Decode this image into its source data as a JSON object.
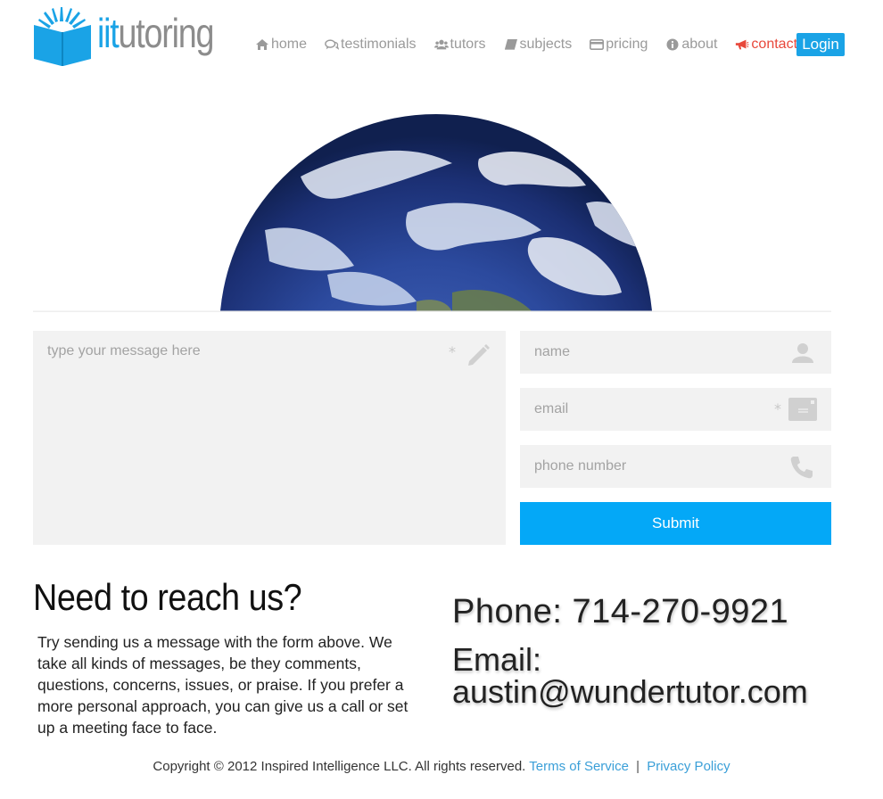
{
  "brand": {
    "name_a": "iit",
    "name_b": "utoring"
  },
  "nav": {
    "items": [
      {
        "label": "home",
        "icon": "home-icon"
      },
      {
        "label": "testimonials",
        "icon": "comments-icon"
      },
      {
        "label": "tutors",
        "icon": "users-icon"
      },
      {
        "label": "subjects",
        "icon": "book-icon"
      },
      {
        "label": "pricing",
        "icon": "credit-card-icon"
      },
      {
        "label": "about",
        "icon": "info-icon"
      },
      {
        "label": "contact",
        "icon": "bullhorn-icon"
      }
    ],
    "active": "contact",
    "login_label": "Login"
  },
  "hero": {
    "image": "earth-globe"
  },
  "form": {
    "message_placeholder": "type your message here",
    "name_placeholder": "name",
    "email_placeholder": "email",
    "phone_placeholder": "phone number",
    "required_mark": "*",
    "submit_label": "Submit"
  },
  "contact": {
    "title": "Need to reach us?",
    "body": "Try sending us a message with the form above. We take all kinds of messages, be they comments, questions, concerns, issues, or praise. If you prefer a more personal approach, you can give us a call or set up a meeting face to face.",
    "phone_line": "Phone: 714-270-9921",
    "email_label": "Email:",
    "email_value": "austin@wundertutor.com"
  },
  "footer": {
    "copyright": "Copyright © 2012 Inspired Intelligence LLC. All rights reserved.",
    "terms": "Terms of Service",
    "separator": "|",
    "privacy": "Privacy Policy"
  },
  "colors": {
    "accent": "#1aa3e6",
    "submit": "#04a8f7",
    "active_nav": "#e8473a",
    "field_bg": "#f2f2f2"
  }
}
